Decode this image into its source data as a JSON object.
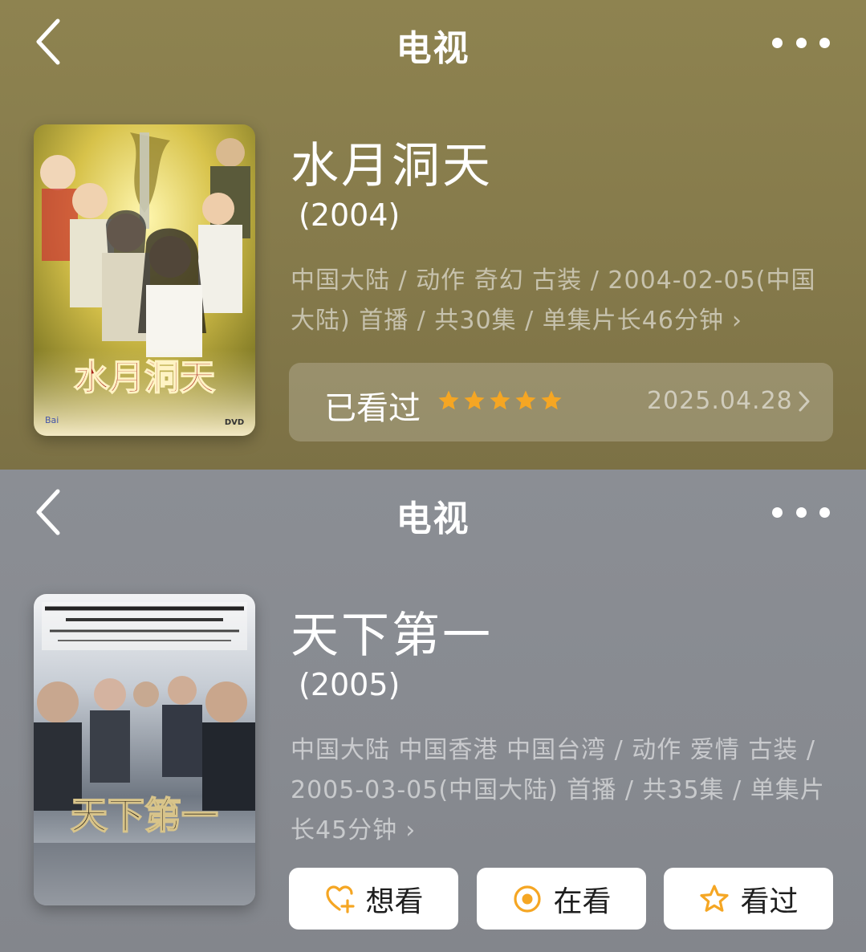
{
  "colors": {
    "panel1_bg": "#877c4c",
    "panel2_bg": "#888b91",
    "star": "#f5a623",
    "action_icon": "#f5a623"
  },
  "panels": [
    {
      "nav": {
        "back_icon": "chevron-left-icon",
        "title": "电视",
        "more_icon": "more-dots-icon"
      },
      "show": {
        "title": "水月洞天",
        "year": "(2004)",
        "meta": "中国大陆 / 动作 奇幻 古装 / 2004-02-05(中国大陆) 首播 / 共30集 / 单集片长46分钟",
        "poster_text": "水月洞天"
      },
      "watched": {
        "label": "已看过",
        "rating_stars": 5,
        "date": "2025.04.28"
      }
    },
    {
      "nav": {
        "back_icon": "chevron-left-icon",
        "title": "电视",
        "more_icon": "more-dots-icon"
      },
      "show": {
        "title": "天下第一",
        "year": "(2005)",
        "meta": "中国大陆 中国香港 中国台湾 / 动作 爱情 古装 / 2005-03-05(中国大陆) 首播 / 共35集 / 单集片长45分钟",
        "poster_text": "天下第一"
      },
      "actions": [
        {
          "label": "想看",
          "icon": "heart-plus-icon"
        },
        {
          "label": "在看",
          "icon": "target-circle-icon"
        },
        {
          "label": "看过",
          "icon": "star-outline-icon"
        }
      ]
    }
  ]
}
